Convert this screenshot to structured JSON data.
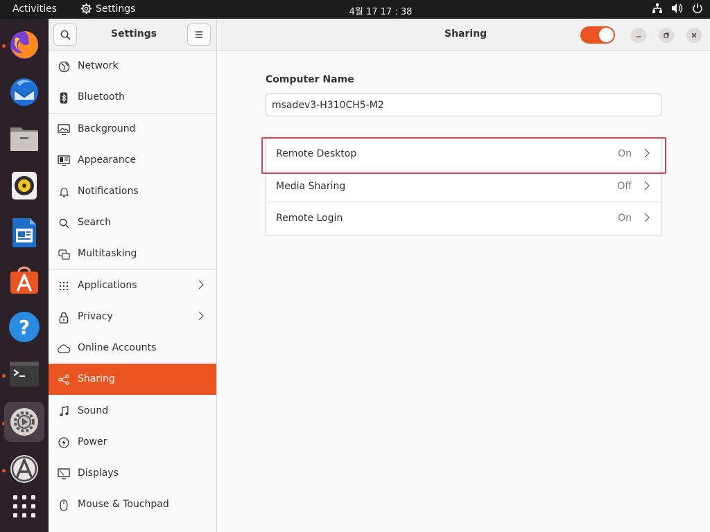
{
  "topbar": {
    "activities": "Activities",
    "app_name": "Settings",
    "clock": "4월 17  17 : 38",
    "tray_icons": [
      "network-icon",
      "volume-icon",
      "power-icon"
    ]
  },
  "dock": {
    "items": [
      {
        "name": "firefox",
        "running": true
      },
      {
        "name": "thunderbird",
        "running": false
      },
      {
        "name": "files",
        "running": false
      },
      {
        "name": "rhythmbox",
        "running": false
      },
      {
        "name": "libreoffice-writer",
        "running": false
      },
      {
        "name": "ubuntu-software",
        "running": false
      },
      {
        "name": "help",
        "running": false
      },
      {
        "name": "terminal",
        "running": true
      },
      {
        "name": "settings",
        "running": true,
        "active": true
      },
      {
        "name": "software-updater",
        "running": true
      },
      {
        "name": "show-applications",
        "running": false
      }
    ]
  },
  "settings": {
    "sidebar_title": "Settings",
    "page_title": "Sharing",
    "sharing_enabled": true,
    "accent_color": "#e95420",
    "nav": [
      {
        "label": "Network",
        "icon": "network-icon"
      },
      {
        "label": "Bluetooth",
        "icon": "bluetooth-icon"
      },
      {
        "label": "Background",
        "icon": "background-icon"
      },
      {
        "label": "Appearance",
        "icon": "appearance-icon"
      },
      {
        "label": "Notifications",
        "icon": "bell-icon"
      },
      {
        "label": "Search",
        "icon": "search-icon"
      },
      {
        "label": "Multitasking",
        "icon": "multitasking-icon"
      },
      {
        "label": "Applications",
        "icon": "grid-icon",
        "chevron": true
      },
      {
        "label": "Privacy",
        "icon": "lock-icon",
        "chevron": true
      },
      {
        "label": "Online Accounts",
        "icon": "cloud-icon"
      },
      {
        "label": "Sharing",
        "icon": "share-icon",
        "selected": true
      },
      {
        "label": "Sound",
        "icon": "music-note-icon"
      },
      {
        "label": "Power",
        "icon": "power-icon"
      },
      {
        "label": "Displays",
        "icon": "display-icon"
      },
      {
        "label": "Mouse & Touchpad",
        "icon": "mouse-icon"
      }
    ]
  },
  "sharing": {
    "computer_name_label": "Computer Name",
    "computer_name_value": "msadev3-H310CH5-M2",
    "rows": [
      {
        "label": "Remote Desktop",
        "status": "On"
      },
      {
        "label": "Media Sharing",
        "status": "Off"
      },
      {
        "label": "Remote Login",
        "status": "On"
      }
    ]
  }
}
